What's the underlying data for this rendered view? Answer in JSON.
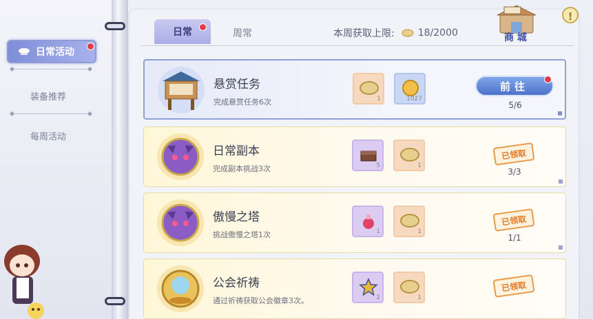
{
  "sidebar": {
    "items": [
      {
        "label": "日常活动",
        "active": true
      },
      {
        "label": "装备推荐",
        "active": false
      },
      {
        "label": "每周活动",
        "active": false
      }
    ]
  },
  "tabs": [
    {
      "label": "日常",
      "active": true
    },
    {
      "label": "周常",
      "active": false
    }
  ],
  "weekly_limit": {
    "label": "本周获取上限:",
    "value": "18/2000"
  },
  "shop": {
    "label": "商 城"
  },
  "help": {
    "label": "!"
  },
  "tasks": [
    {
      "title": "悬赏任务",
      "desc": "完成悬赏任务6次",
      "rewards": [
        {
          "icon": "badge-coin-icon",
          "qty": "1"
        },
        {
          "icon": "gold-coin-icon",
          "qty": "1027"
        }
      ],
      "status": "go",
      "button_label": "前往",
      "progress": "5/6"
    },
    {
      "title": "日常副本",
      "desc": "完成副本挑战3次",
      "rewards": [
        {
          "icon": "treasure-chest-icon",
          "qty": "5"
        },
        {
          "icon": "badge-coin-icon",
          "qty": "1"
        }
      ],
      "status": "claimed",
      "status_label": "已领取",
      "progress": "3/3"
    },
    {
      "title": "傲慢之塔",
      "desc": "挑战傲慢之塔1次",
      "rewards": [
        {
          "icon": "potion-icon",
          "qty": "1"
        },
        {
          "icon": "badge-coin-icon",
          "qty": "1"
        }
      ],
      "status": "claimed",
      "status_label": "已领取",
      "progress": "1/1"
    },
    {
      "title": "公会祈祷",
      "desc": "通过祈祷获取公会徽章3次。",
      "rewards": [
        {
          "icon": "star-icon",
          "qty": "2"
        },
        {
          "icon": "badge-coin-icon",
          "qty": "1"
        }
      ],
      "status": "claimed",
      "status_label": "已领取",
      "progress": ""
    }
  ],
  "colors": {
    "accent": "#4d72c9",
    "claimed": "#e37c28",
    "tab_active": "#a9aee6"
  }
}
